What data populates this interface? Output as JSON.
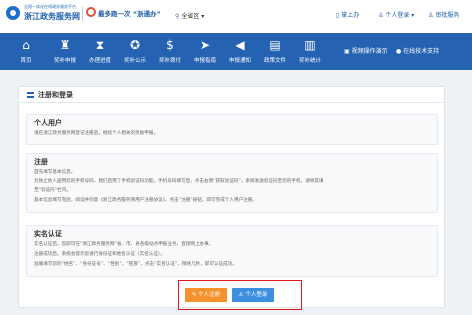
{
  "header": {
    "logo_small": "全国一体化在线政务服务平台",
    "logo_main": "浙江政务服务网",
    "slogan": "最多跑一次 “浙通办”",
    "location": "全省区",
    "links": [
      "掌上办",
      "个人登录",
      "审批服务"
    ]
  },
  "nav": {
    "items": [
      {
        "label": "首页",
        "icon": "home-icon",
        "glyph": "⌂"
      },
      {
        "label": "奖补申报",
        "icon": "trophy-icon",
        "glyph": "♜"
      },
      {
        "label": "办理进度",
        "icon": "hourglass-icon",
        "glyph": "⧗"
      },
      {
        "label": "奖补公示",
        "icon": "medal-icon",
        "glyph": "✪"
      },
      {
        "label": "奖补拨付",
        "icon": "bag-icon",
        "glyph": "$"
      },
      {
        "label": "申报指南",
        "icon": "compass-icon",
        "glyph": "➤"
      },
      {
        "label": "申报通知",
        "icon": "speaker-icon",
        "glyph": "◀"
      },
      {
        "label": "政策文件",
        "icon": "document-icon",
        "glyph": "▤"
      },
      {
        "label": "奖补统计",
        "icon": "chart-icon",
        "glyph": "▥"
      }
    ],
    "video_demo": "视频操作演示",
    "online_support": "在线技术支持"
  },
  "panel": {
    "title": "注册和登录",
    "sections": [
      {
        "title": "个人用户",
        "lines": [
          "请在浙江政务服务网登记注册后，继续个人相关的奖励申报。"
        ]
      },
      {
        "title": "注册",
        "lines": [
          "首先填写基本信息。",
          "为防止他人盗用您的手机号码，我们启用了手机验证码功能。手机号码填写后，点击右侧“获取验证码”，系统发送验证码至您的手机，请将其填",
          "至“验证码”栏内。",
          "基本信息填写完后，阅读并同意《浙江政务服务网用户注册协议》，点击“注册”按钮，即可完成个人用户注册。"
        ]
      },
      {
        "title": "实名认证",
        "lines": [
          "实名认证后，您即可在“浙江政务服务网”省、市、县各级站点申报业务，直接网上办事。",
          "注册成功后，系统会提示您进行身份证和姓名认证（实名认证）。",
          "准确填写您的“姓名”、“身份证号”、“性别”、“民族”，点击“实名认证”，稍待几秒，即可认证成功。"
        ]
      }
    ],
    "register_button": "个人注册",
    "login_button": "个人登录"
  },
  "colors": {
    "nav_bg": "#2562b2",
    "register_btn": "#f5922e",
    "login_btn": "#3d8fe0",
    "highlight_border": "#e21a1a"
  }
}
